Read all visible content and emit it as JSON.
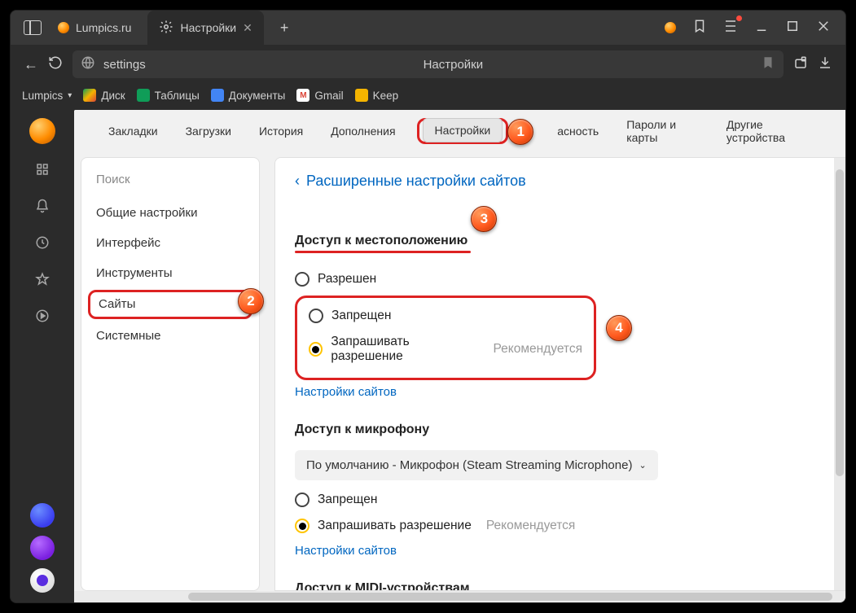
{
  "tabs": {
    "t1": "Lumpics.ru",
    "t2": "Настройки",
    "add": "+"
  },
  "addr": {
    "url": "settings",
    "label": "Настройки"
  },
  "bookmarks_bar": {
    "folder": "Lumpics",
    "disk": "Диск",
    "sheets": "Таблицы",
    "docs": "Документы",
    "gmail": "Gmail",
    "keep": "Keep"
  },
  "topnav": {
    "bookmarks": "Закладки",
    "downloads": "Загрузки",
    "history": "История",
    "addons": "Дополнения",
    "settings": "Настройки",
    "security_frag": "асность",
    "passwords": "Пароли и карты",
    "devices": "Другие устройства"
  },
  "sidebar": {
    "search": "Поиск",
    "items": {
      "general": "Общие настройки",
      "interface": "Интерфейс",
      "tools": "Инструменты",
      "sites": "Сайты",
      "system": "Системные"
    }
  },
  "main": {
    "back": "Расширенные настройки сайтов",
    "location": {
      "title": "Доступ к местоположению",
      "allowed": "Разрешен",
      "denied": "Запрещен",
      "ask": "Запрашивать разрешение",
      "hint": "Рекомендуется",
      "sites": "Настройки сайтов"
    },
    "mic": {
      "title": "Доступ к микрофону",
      "dropdown": "По умолчанию - Микрофон (Steam Streaming Microphone)",
      "denied": "Запрещен",
      "ask": "Запрашивать разрешение",
      "hint": "Рекомендуется",
      "sites": "Настройки сайтов"
    },
    "midi": {
      "title": "Доступ к MIDI-устройствам"
    }
  },
  "callouts": {
    "c1": "1",
    "c2": "2",
    "c3": "3",
    "c4": "4"
  }
}
